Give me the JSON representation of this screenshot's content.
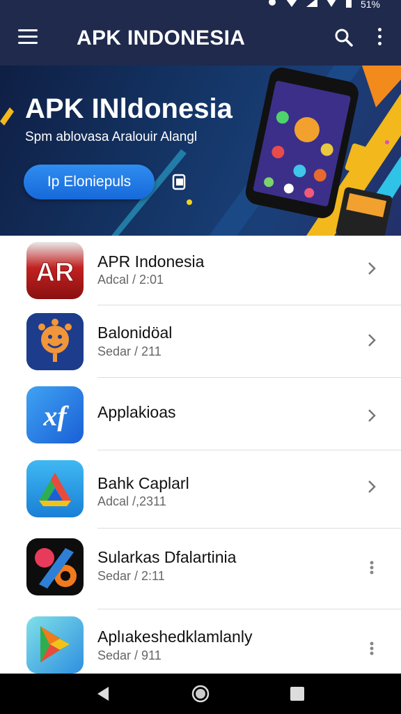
{
  "status_bar": {
    "battery_text": "51%"
  },
  "app_bar": {
    "title": "APK INDONESIA"
  },
  "banner": {
    "title": "APK INldonesia",
    "subtitle": "Spm ablovasa Aralouir Alangl",
    "cta_label": "Ip Eloniepuls"
  },
  "apps": [
    {
      "name": "APR Indonesia",
      "subtitle": "Adcal / 2:01",
      "icon": "apr-logo-icon",
      "action": "chevron-right-icon"
    },
    {
      "name": "Balonidöal",
      "subtitle": "Sedar / 211",
      "icon": "smiley-sun-icon",
      "action": "chevron-right-icon"
    },
    {
      "name": "Applakioas",
      "subtitle": "",
      "icon": "xf-logo-icon",
      "action": "chevron-right-icon"
    },
    {
      "name": "Bahk Caplarl",
      "subtitle": "Adcal /,2311",
      "icon": "drive-triangle-icon",
      "action": "chevron-right-icon"
    },
    {
      "name": "Sularkas Dfalartinia",
      "subtitle": "Sedar / 2:11",
      "icon": "colorful-swirl-icon",
      "action": "more-vertical-icon"
    },
    {
      "name": "Aplıakeshedklamlanly",
      "subtitle": "Sedar / 911",
      "icon": "play-store-icon",
      "action": "more-vertical-icon"
    }
  ],
  "colors": {
    "app_bar": "#1f2a4d",
    "banner_bg": "#143566",
    "cta": "#1f7be6",
    "nav_bar": "#000000"
  }
}
